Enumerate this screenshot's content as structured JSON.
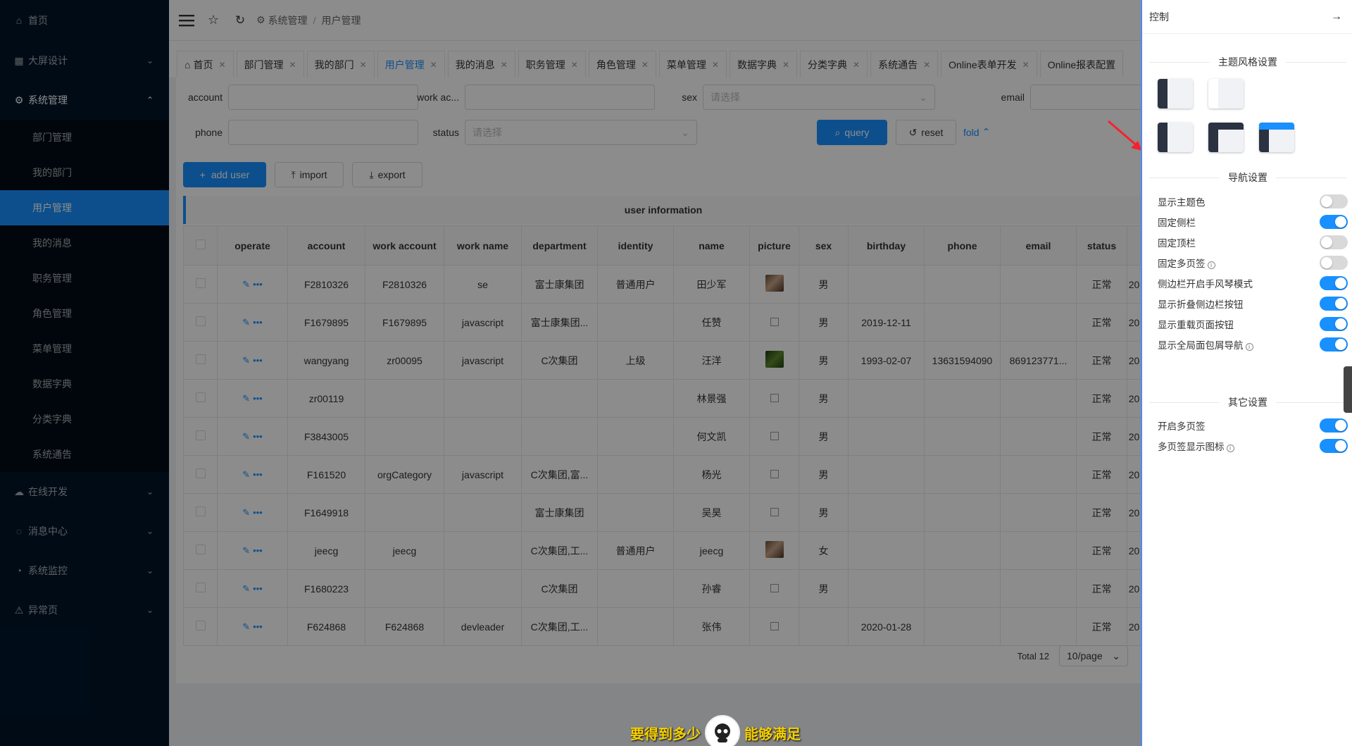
{
  "sidebar": {
    "home": "首页",
    "bigscreen": "大屏设计",
    "system": "系统管理",
    "system_items": [
      "部门管理",
      "我的部门",
      "用户管理",
      "我的消息",
      "职务管理",
      "角色管理",
      "菜单管理",
      "数据字典",
      "分类字典",
      "系统通告"
    ],
    "online": "在线开发",
    "message": "消息中心",
    "monitor": "系统监控",
    "error": "异常页"
  },
  "breadcrumb": {
    "root": "系统管理",
    "sep": "/",
    "current": "用户管理"
  },
  "tabs": [
    {
      "label": "首页"
    },
    {
      "label": "部门管理"
    },
    {
      "label": "我的部门"
    },
    {
      "label": "用户管理"
    },
    {
      "label": "我的消息"
    },
    {
      "label": "职务管理"
    },
    {
      "label": "角色管理"
    },
    {
      "label": "菜单管理"
    },
    {
      "label": "数据字典"
    },
    {
      "label": "分类字典"
    },
    {
      "label": "系统通告"
    },
    {
      "label": "Online表单开发"
    },
    {
      "label": "Online报表配置"
    }
  ],
  "search": {
    "account_label": "account",
    "work_account_label": "work ac...",
    "sex_label": "sex",
    "sex_placeholder": "请选择",
    "email_label": "email",
    "phone_label": "phone",
    "status_label": "status",
    "status_placeholder": "请选择",
    "query": "query",
    "reset": "reset",
    "fold": "fold"
  },
  "toolbar": {
    "add": "add user",
    "import": "import",
    "export": "export"
  },
  "table": {
    "title": "user information",
    "headers": [
      "operate",
      "account",
      "work account",
      "work name",
      "department",
      "identity",
      "name",
      "picture",
      "sex",
      "birthday",
      "phone",
      "email",
      "status",
      ""
    ],
    "rows": [
      {
        "account": "F2810326",
        "work_account": "F2810326",
        "work_name": "se",
        "department": "富士康集团",
        "identity": "普通用户",
        "name": "田少军",
        "picture": "photo",
        "sex": "男",
        "birthday": "",
        "phone": "",
        "email": "",
        "status": "正常",
        "extra": "20"
      },
      {
        "account": "F1679895",
        "work_account": "F1679895",
        "work_name": "javascript",
        "department": "富士康集团...",
        "identity": "",
        "name": "任赞",
        "picture": "icon",
        "sex": "男",
        "birthday": "2019-12-11",
        "phone": "",
        "email": "",
        "status": "正常",
        "extra": "20"
      },
      {
        "account": "wangyang",
        "work_account": "zr00095",
        "work_name": "javascript",
        "department": "C次集团",
        "identity": "上级",
        "name": "汪洋",
        "picture": "photo-green",
        "sex": "男",
        "birthday": "1993-02-07",
        "phone": "13631594090",
        "email": "869123771...",
        "status": "正常",
        "extra": "20"
      },
      {
        "account": "zr00119",
        "work_account": "",
        "work_name": "",
        "department": "",
        "identity": "",
        "name": "林景强",
        "picture": "icon",
        "sex": "男",
        "birthday": "",
        "phone": "",
        "email": "",
        "status": "正常",
        "extra": "20"
      },
      {
        "account": "F3843005",
        "work_account": "",
        "work_name": "",
        "department": "",
        "identity": "",
        "name": "何文凯",
        "picture": "icon",
        "sex": "男",
        "birthday": "",
        "phone": "",
        "email": "",
        "status": "正常",
        "extra": "20"
      },
      {
        "account": "F161520",
        "work_account": "orgCategory",
        "work_name": "javascript",
        "department": "C次集团,富...",
        "identity": "",
        "name": "杨光",
        "picture": "icon",
        "sex": "男",
        "birthday": "",
        "phone": "",
        "email": "",
        "status": "正常",
        "extra": "20"
      },
      {
        "account": "F1649918",
        "work_account": "",
        "work_name": "",
        "department": "富士康集团",
        "identity": "",
        "name": "吴昊",
        "picture": "icon",
        "sex": "男",
        "birthday": "",
        "phone": "",
        "email": "",
        "status": "正常",
        "extra": "20"
      },
      {
        "account": "jeecg",
        "work_account": "jeecg",
        "work_name": "",
        "department": "C次集团,工...",
        "identity": "普通用户",
        "name": "jeecg",
        "picture": "photo",
        "sex": "女",
        "birthday": "",
        "phone": "",
        "email": "",
        "status": "正常",
        "extra": "20"
      },
      {
        "account": "F1680223",
        "work_account": "",
        "work_name": "",
        "department": "C次集团",
        "identity": "",
        "name": "孙睿",
        "picture": "icon",
        "sex": "男",
        "birthday": "",
        "phone": "",
        "email": "",
        "status": "正常",
        "extra": "20"
      },
      {
        "account": "F624868",
        "work_account": "F624868",
        "work_name": "devleader",
        "department": "C次集团,工...",
        "identity": "",
        "name": "张伟",
        "picture": "icon",
        "sex": "",
        "birthday": "2020-01-28",
        "phone": "",
        "email": "",
        "status": "正常",
        "extra": "20"
      }
    ]
  },
  "pagination": {
    "total": "Total 12",
    "page_size": "10/page"
  },
  "drawer": {
    "title": "控制",
    "theme_section": "主题风格设置",
    "nav_section": "导航设置",
    "other_section": "其它设置",
    "nav_settings": [
      {
        "label": "显示主题色",
        "on": false,
        "info": false
      },
      {
        "label": "固定侧栏",
        "on": true,
        "info": false
      },
      {
        "label": "固定顶栏",
        "on": false,
        "info": false
      },
      {
        "label": "固定多页签",
        "on": false,
        "info": true
      },
      {
        "label": "侧边栏开启手风琴模式",
        "on": true,
        "info": false
      },
      {
        "label": "显示折叠侧边栏按钮",
        "on": true,
        "info": false
      },
      {
        "label": "显示重载页面按钮",
        "on": true,
        "info": false
      },
      {
        "label": "显示全局面包屑导航",
        "on": true,
        "info": true
      }
    ],
    "other_settings": [
      {
        "label": "开启多页签",
        "on": true,
        "info": false
      },
      {
        "label": "多页签显示图标",
        "on": true,
        "info": true
      }
    ]
  },
  "caption": {
    "left": "要得到多少",
    "right": "能够满足"
  },
  "colors": {
    "primary": "#1890ff",
    "sidebar": "#001529",
    "arrow": "#f5222d"
  }
}
